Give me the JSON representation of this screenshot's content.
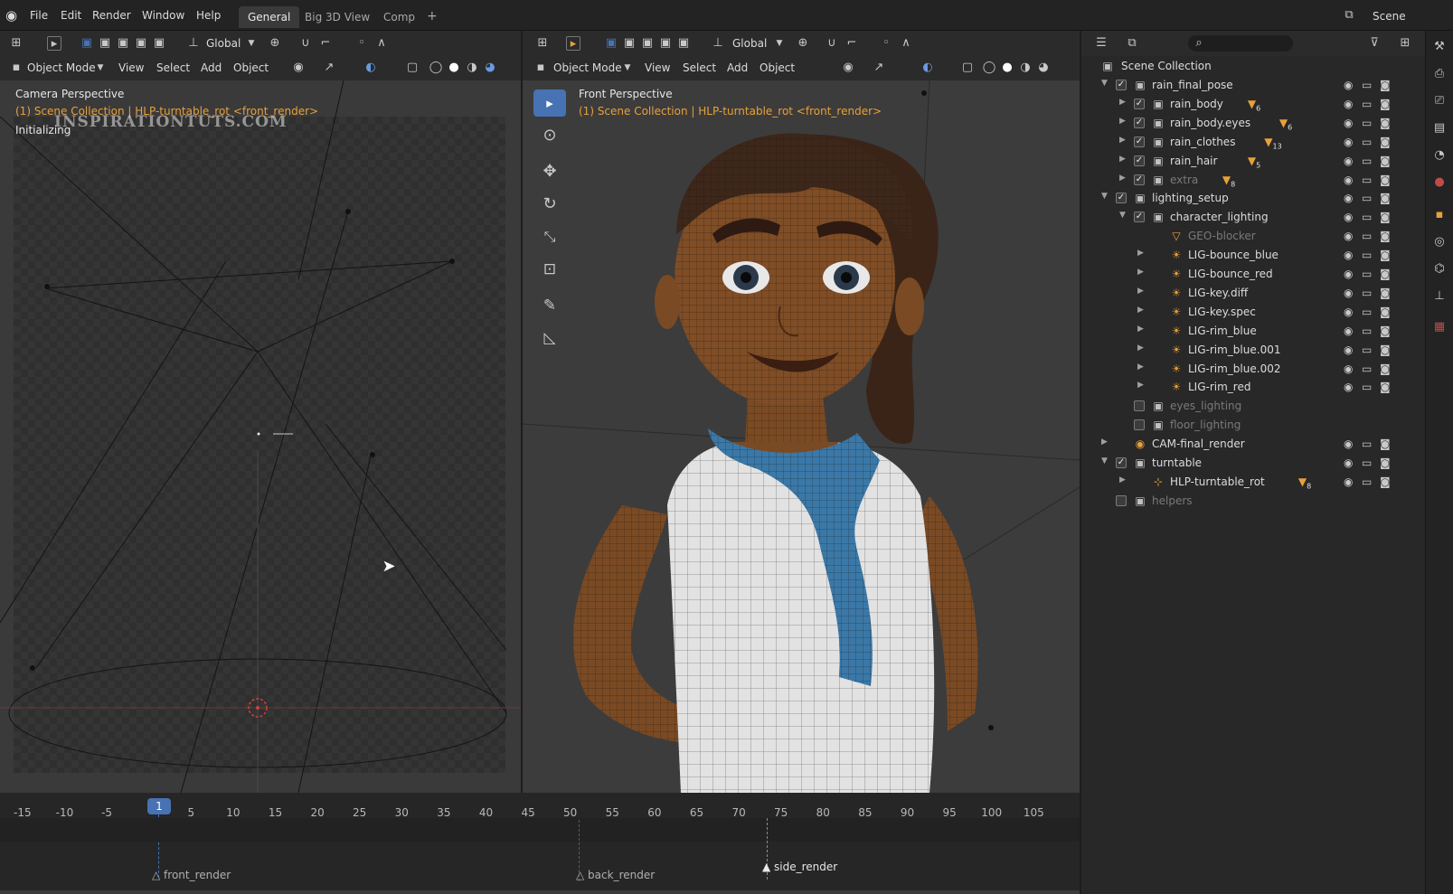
{
  "topbar": {
    "menu": [
      "File",
      "Edit",
      "Render",
      "Window",
      "Help"
    ],
    "tabs": [
      "General",
      "Big 3D View",
      "Comp"
    ],
    "active_tab": "General",
    "add_tab": "+",
    "scene_label": "Scene"
  },
  "left_viewport": {
    "transform_orientation": "Global",
    "mode": "Object Mode",
    "menus": [
      "View",
      "Select",
      "Add",
      "Object"
    ],
    "view_name": "Camera Perspective",
    "collection_info": "(1) Scene Collection | HLP-turntable_rot <front_render>",
    "watermark": "INSPIRATIONTUTS.COM",
    "status": "Initializing"
  },
  "right_viewport": {
    "transform_orientation": "Global",
    "mode": "Object Mode",
    "menus": [
      "View",
      "Select",
      "Add",
      "Object"
    ],
    "view_name": "Front Perspective",
    "collection_info": "(1) Scene Collection | HLP-turntable_rot <front_render>"
  },
  "outliner": {
    "root": "Scene Collection",
    "rows": [
      {
        "label": "rain_final_pose",
        "badge": ""
      },
      {
        "label": "rain_body",
        "badge": "6"
      },
      {
        "label": "rain_body.eyes",
        "badge": "6"
      },
      {
        "label": "rain_clothes",
        "badge": "13"
      },
      {
        "label": "rain_hair",
        "badge": "5"
      },
      {
        "label": "extra",
        "badge": "8"
      },
      {
        "label": "lighting_setup",
        "badge": ""
      },
      {
        "label": "character_lighting",
        "badge": ""
      },
      {
        "label": "GEO-blocker",
        "badge": ""
      },
      {
        "label": "LIG-bounce_blue",
        "badge": ""
      },
      {
        "label": "LIG-bounce_red",
        "badge": ""
      },
      {
        "label": "LIG-key.diff",
        "badge": ""
      },
      {
        "label": "LIG-key.spec",
        "badge": ""
      },
      {
        "label": "LIG-rim_blue",
        "badge": ""
      },
      {
        "label": "LIG-rim_blue.001",
        "badge": ""
      },
      {
        "label": "LIG-rim_blue.002",
        "badge": ""
      },
      {
        "label": "LIG-rim_red",
        "badge": ""
      },
      {
        "label": "eyes_lighting",
        "badge": ""
      },
      {
        "label": "floor_lighting",
        "badge": ""
      },
      {
        "label": "CAM-final_render",
        "badge": ""
      },
      {
        "label": "turntable",
        "badge": ""
      },
      {
        "label": "HLP-turntable_rot",
        "badge": "8"
      },
      {
        "label": "helpers",
        "badge": ""
      }
    ]
  },
  "timeline": {
    "current_frame": "1",
    "ticks": [
      "-15",
      "-10",
      "-5",
      "5",
      "10",
      "15",
      "20",
      "25",
      "30",
      "35",
      "40",
      "45",
      "50",
      "55",
      "60",
      "65",
      "70",
      "75",
      "80",
      "85",
      "90",
      "95",
      "100",
      "105"
    ],
    "markers": [
      "front_render",
      "back_render",
      "side_render"
    ]
  },
  "colors": {
    "accent_blue": "#4772b3",
    "info_orange": "#e8a03a",
    "keyframe": "#e0a040"
  }
}
